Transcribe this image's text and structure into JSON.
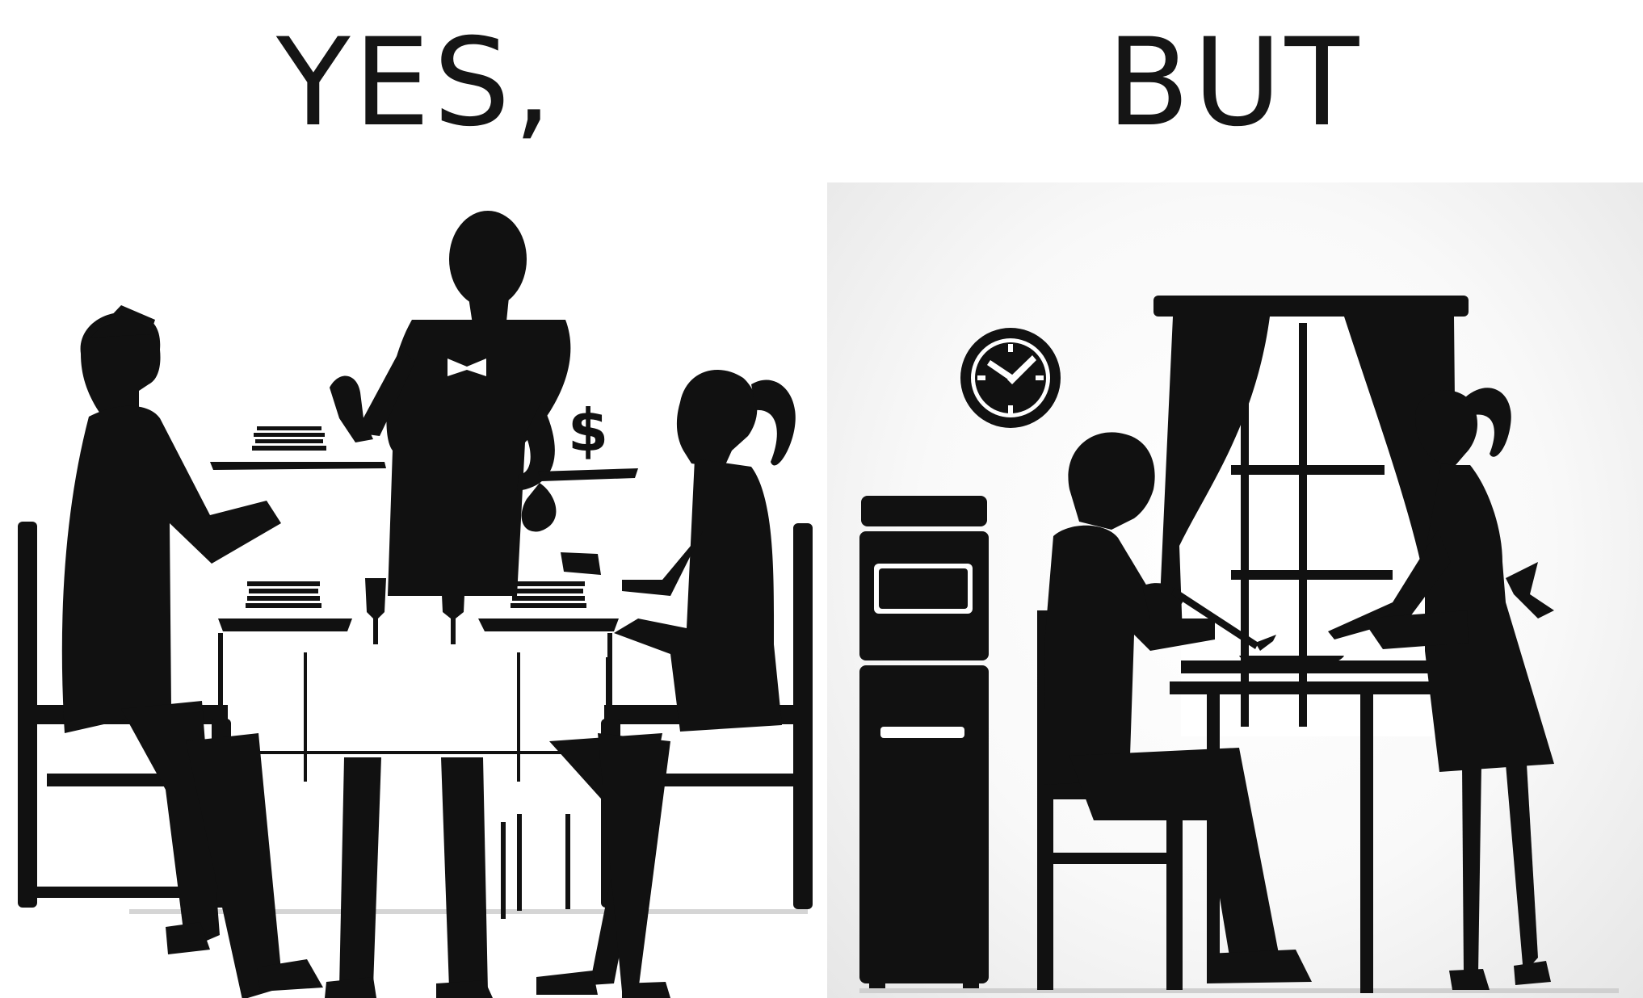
{
  "captions": {
    "left": "YES,",
    "right": "BUT"
  },
  "left_panel": {
    "sign_on_tray": "$"
  },
  "colors": {
    "ink": "#111111",
    "background": "#ffffff"
  },
  "icons": {
    "clock": "wall-clock-icon",
    "money": "dollar-sign-icon"
  }
}
